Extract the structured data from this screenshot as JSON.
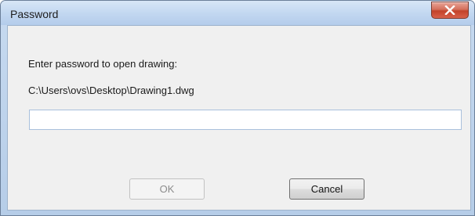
{
  "window": {
    "title": "Password"
  },
  "dialog": {
    "prompt": "Enter password to open drawing:",
    "file_path": "C:\\Users\\ovs\\Desktop\\Drawing1.dwg",
    "password_value": "",
    "password_placeholder": ""
  },
  "buttons": {
    "ok_label": "OK",
    "ok_enabled": false,
    "cancel_label": "Cancel"
  },
  "icons": {
    "close": "close-icon"
  },
  "colors": {
    "title_bar": "#c3d8f1",
    "close_button": "#c3432a",
    "client_bg": "#f0f0f0"
  }
}
